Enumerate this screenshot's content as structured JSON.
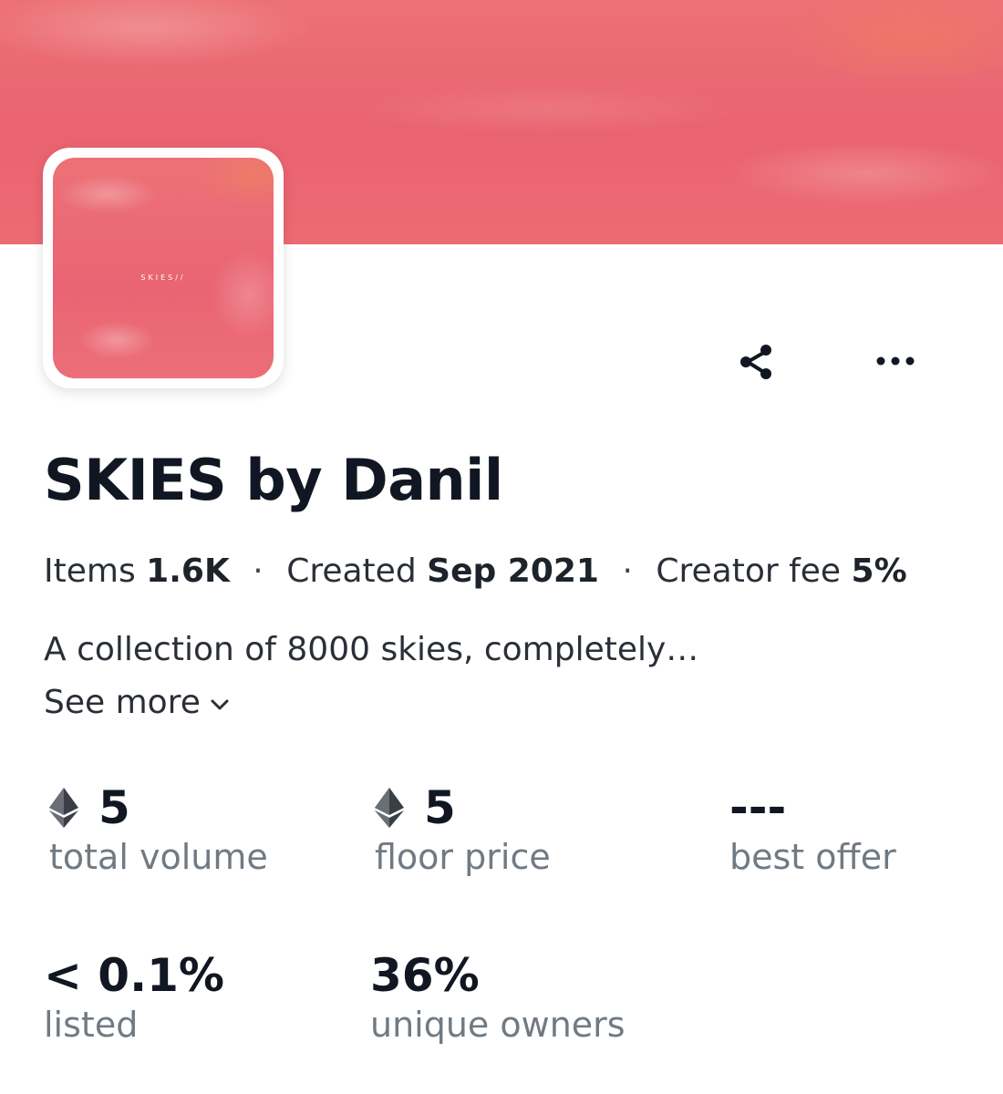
{
  "avatar": {
    "text": "SKIES//"
  },
  "actions": {
    "share_icon": "share-icon",
    "more_icon": "more-horizontal-icon"
  },
  "collection": {
    "title": "SKIES by Danil",
    "meta": {
      "items_label": "Items",
      "items_value": "1.6K",
      "created_label": "Created",
      "created_value": "Sep 2021",
      "fee_label": "Creator fee",
      "fee_value": "5%",
      "separator": "·"
    },
    "description": "A collection of 8000 skies, completely…",
    "see_more": "See more"
  },
  "stats": {
    "total_volume": {
      "value": "5",
      "label": "total volume",
      "icon": "ethereum-icon"
    },
    "floor_price": {
      "value": "5",
      "label": "floor price",
      "icon": "ethereum-icon"
    },
    "best_offer": {
      "value": "---",
      "label": "best offer"
    },
    "listed": {
      "value": "< 0.1%",
      "label": "listed"
    },
    "unique_owners": {
      "value": "36%",
      "label": "unique owners"
    }
  },
  "colors": {
    "banner": "#ea6370",
    "text_primary": "#111722",
    "text_secondary": "#707a83"
  }
}
